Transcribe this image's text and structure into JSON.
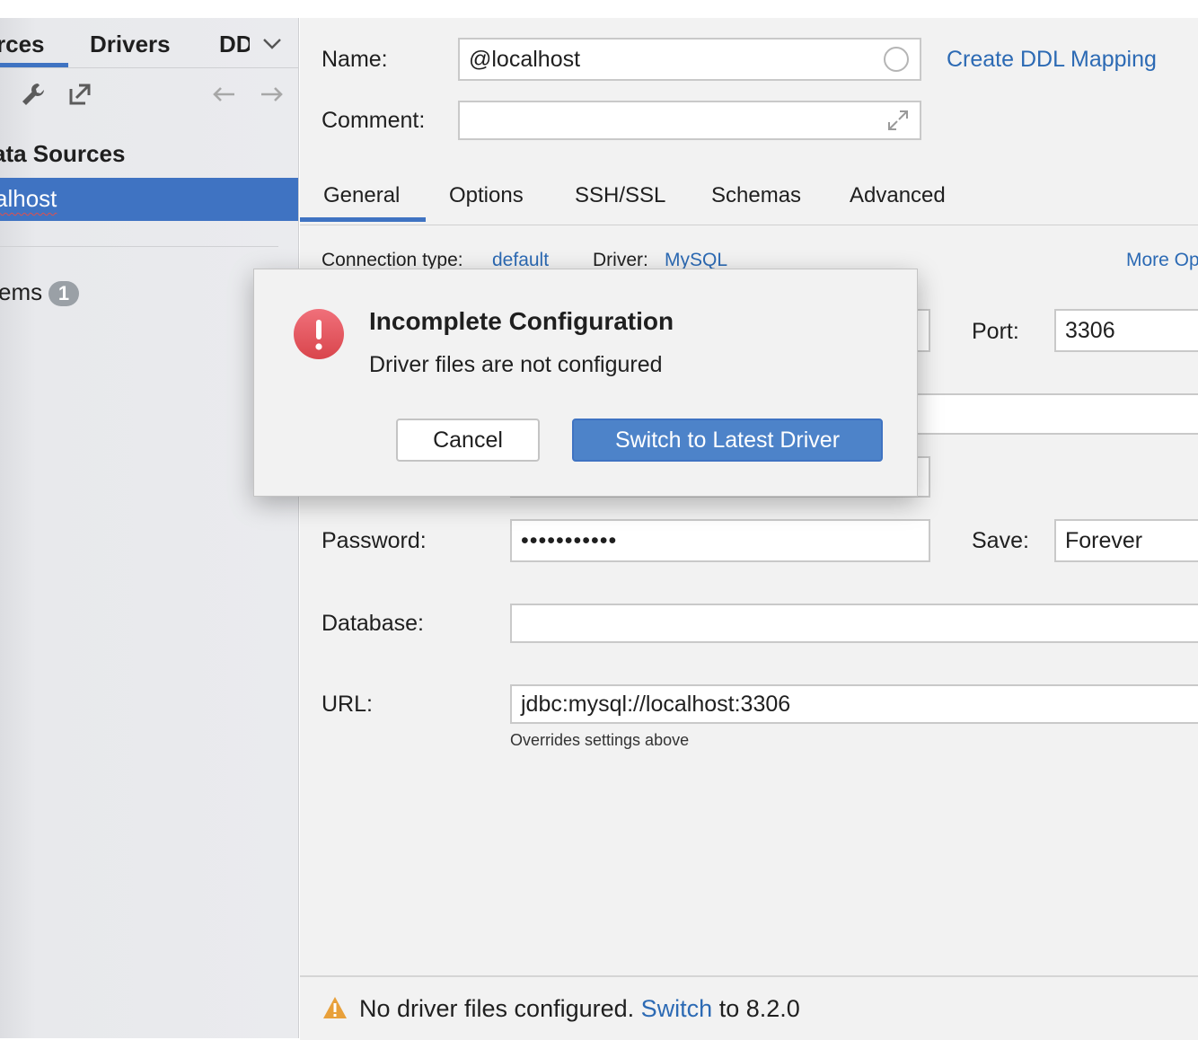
{
  "sidebar": {
    "tabs": [
      {
        "label": "rces"
      },
      {
        "label": "Drivers"
      },
      {
        "label": "DD"
      }
    ],
    "section_heading": "ata Sources",
    "selected_item": "alhost",
    "problems_label": "ems",
    "problems_count": "1"
  },
  "form": {
    "name_label": "Name:",
    "name_value": "@localhost",
    "create_ddl_link": "Create DDL Mapping",
    "comment_label": "Comment:",
    "comment_value": "",
    "tabs": [
      "General",
      "Options",
      "SSH/SSL",
      "Schemas",
      "Advanced"
    ],
    "connection_type_label": "Connection type:",
    "connection_type_value": "default",
    "driver_label": "Driver:",
    "driver_value": "MySQL",
    "more_options": "More Op",
    "port_label": "Port:",
    "port_value": "3306",
    "password_label": "Password:",
    "password_value": "•••••••••••",
    "save_label": "Save:",
    "save_value": "Forever",
    "database_label": "Database:",
    "database_value": "",
    "url_label": "URL:",
    "url_value": "jdbc:mysql://localhost:3306",
    "url_hint": "Overrides settings above"
  },
  "status": {
    "message_prefix": "No driver files configured.",
    "switch_link": "Switch",
    "message_suffix": "to 8.2.0"
  },
  "dialog": {
    "title": "Incomplete Configuration",
    "message": "Driver files are not configured",
    "cancel_label": "Cancel",
    "switch_label": "Switch to Latest Driver"
  },
  "colors": {
    "accent": "#3f73c2",
    "link": "#2c6ab4",
    "error": "#e0504c",
    "warning": "#e8a03a"
  }
}
